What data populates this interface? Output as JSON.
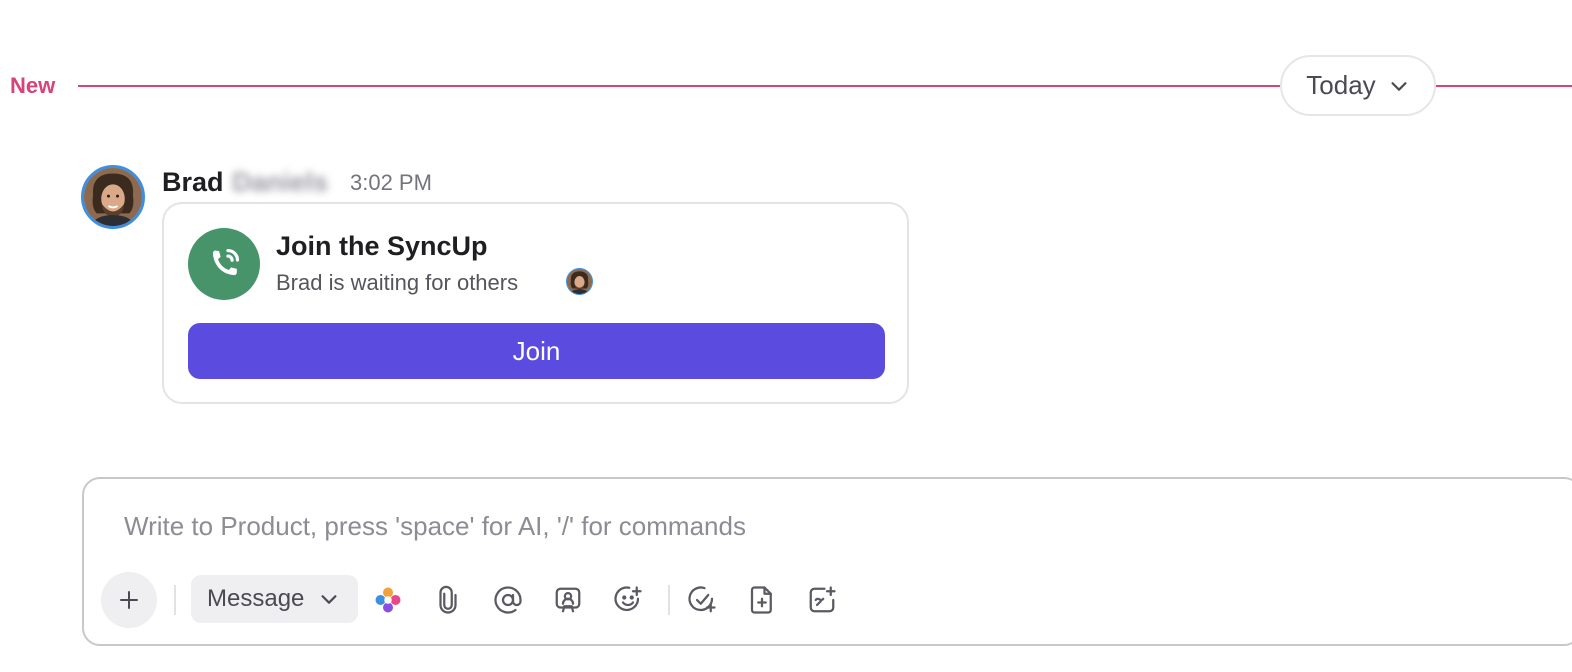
{
  "divider": {
    "new_label": "New",
    "date_label": "Today",
    "accent_color": "#d8437a"
  },
  "message": {
    "author_first": "Brad",
    "author_last": "Daniels",
    "time": "3:02 PM",
    "avatar_icon": "user-avatar",
    "card": {
      "icon": "phone-call-icon",
      "icon_color": "#47946a",
      "title": "Join the SyncUp",
      "subtitle": "Brad is waiting for others",
      "button_label": "Join",
      "button_color": "#5b4cdf"
    }
  },
  "composer": {
    "placeholder": "Write to Product, press 'space' for AI, '/' for commands",
    "value": "",
    "message_type": "Message",
    "toolbar_icons": [
      "plus-icon",
      "chevron-down-icon",
      "ai-sparkle-icon",
      "paperclip-icon",
      "at-mention-icon",
      "clip-record-icon",
      "emoji-add-icon",
      "task-add-icon",
      "doc-add-icon",
      "whiteboard-add-icon"
    ]
  }
}
